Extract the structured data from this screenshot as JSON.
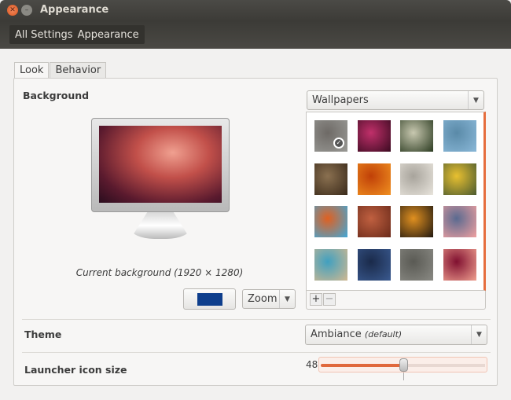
{
  "window": {
    "title": "Appearance"
  },
  "toolbar": {
    "breadcrumbs": [
      "All Settings",
      "Appearance"
    ]
  },
  "tabs": [
    {
      "label": "Look",
      "active": true
    },
    {
      "label": "Behavior",
      "active": false
    }
  ],
  "background": {
    "heading": "Background",
    "caption": "Current background (1920 × 1280)",
    "source": "Wallpapers",
    "color_swatch": "#0e3e8c",
    "mode": "Zoom",
    "thumbnails": [
      {
        "colors": [
          "#9a9a96",
          "#6e6a66"
        ],
        "selected": true
      },
      {
        "colors": [
          "#3a0a20",
          "#c0306a"
        ]
      },
      {
        "colors": [
          "#2a3a20",
          "#c8c8b0"
        ]
      },
      {
        "colors": [
          "#8ab8d8",
          "#5a8aa8"
        ]
      },
      {
        "colors": [
          "#3a2a1a",
          "#8a7050"
        ]
      },
      {
        "colors": [
          "#f09020",
          "#c04008"
        ]
      },
      {
        "colors": [
          "#e8e4dc",
          "#a8a49c"
        ]
      },
      {
        "colors": [
          "#4a5a30",
          "#e8c030"
        ]
      },
      {
        "colors": [
          "#40a8d8",
          "#e06020"
        ]
      },
      {
        "colors": [
          "#6a2a1a",
          "#c06040"
        ]
      },
      {
        "colors": [
          "#201810",
          "#e09020"
        ]
      },
      {
        "colors": [
          "#f0a0a0",
          "#5a6a90"
        ]
      },
      {
        "colors": [
          "#d0b890",
          "#40a0c0"
        ]
      },
      {
        "colors": [
          "#3a5a90",
          "#1a2a4a"
        ]
      },
      {
        "colors": [
          "#8a8a84",
          "#5a5a54"
        ]
      },
      {
        "colors": [
          "#f0a090",
          "#801030"
        ]
      }
    ],
    "add_label": "+",
    "remove_label": "−"
  },
  "theme": {
    "heading": "Theme",
    "value": "Ambiance",
    "suffix": "(default)"
  },
  "launcher": {
    "heading": "Launcher icon size",
    "value": "48",
    "slider_fraction": 0.5
  },
  "colors": {
    "accent": "#e0683c"
  }
}
